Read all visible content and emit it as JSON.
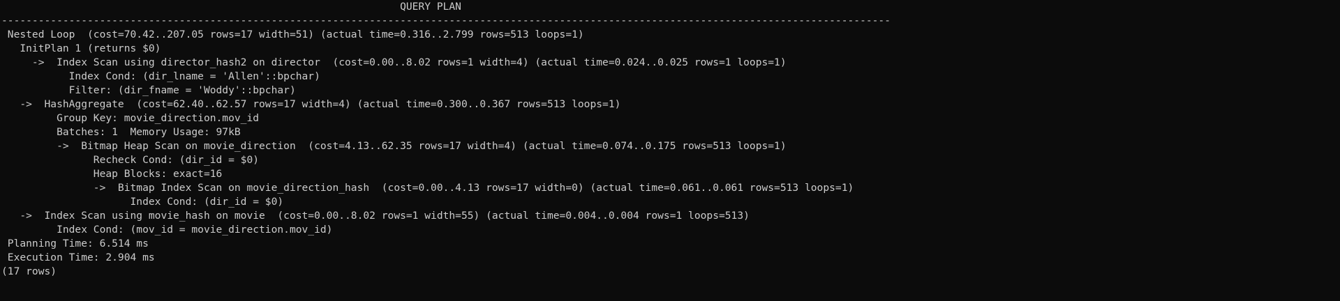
{
  "terminal": {
    "lines": [
      "                                                                 QUERY PLAN",
      "-------------------------------------------------------------------------------------------------------------------------------------------------",
      " Nested Loop  (cost=70.42..207.05 rows=17 width=51) (actual time=0.316..2.799 rows=513 loops=1)",
      "   InitPlan 1 (returns $0)",
      "     ->  Index Scan using director_hash2 on director  (cost=0.00..8.02 rows=1 width=4) (actual time=0.024..0.025 rows=1 loops=1)",
      "           Index Cond: (dir_lname = 'Allen'::bpchar)",
      "           Filter: (dir_fname = 'Woddy'::bpchar)",
      "   ->  HashAggregate  (cost=62.40..62.57 rows=17 width=4) (actual time=0.300..0.367 rows=513 loops=1)",
      "         Group Key: movie_direction.mov_id",
      "         Batches: 1  Memory Usage: 97kB",
      "         ->  Bitmap Heap Scan on movie_direction  (cost=4.13..62.35 rows=17 width=4) (actual time=0.074..0.175 rows=513 loops=1)",
      "               Recheck Cond: (dir_id = $0)",
      "               Heap Blocks: exact=16",
      "               ->  Bitmap Index Scan on movie_direction_hash  (cost=0.00..4.13 rows=17 width=0) (actual time=0.061..0.061 rows=513 loops=1)",
      "                     Index Cond: (dir_id = $0)",
      "   ->  Index Scan using movie_hash on movie  (cost=0.00..8.02 rows=1 width=55) (actual time=0.004..0.004 rows=1 loops=513)",
      "         Index Cond: (mov_id = movie_direction.mov_id)",
      " Planning Time: 6.514 ms",
      " Execution Time: 2.904 ms",
      "(17 rows)"
    ]
  }
}
